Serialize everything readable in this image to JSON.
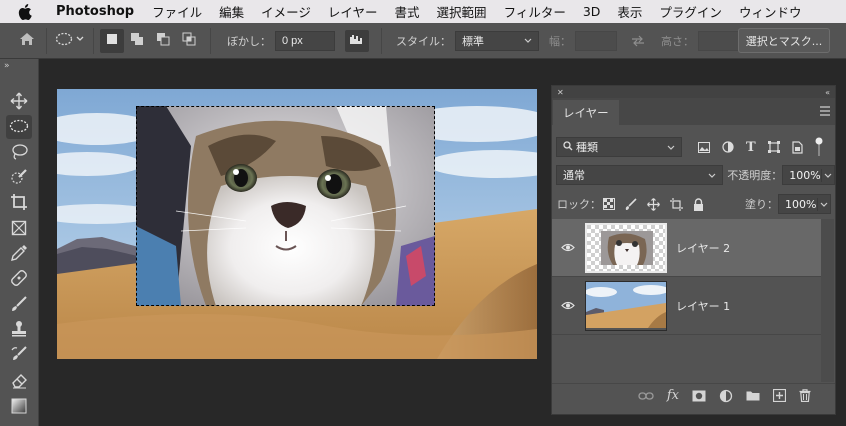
{
  "menubar": {
    "app_name": "Photoshop",
    "items": [
      "ファイル",
      "編集",
      "イメージ",
      "レイヤー",
      "書式",
      "選択範囲",
      "フィルター",
      "3D",
      "表示",
      "プラグイン",
      "ウィンドウ"
    ]
  },
  "options": {
    "feather_label": "ぼかし：",
    "feather_value": "0 px",
    "style_label": "スタイル：",
    "style_value": "標準",
    "width_label": "幅：",
    "height_label": "高さ：",
    "select_mask_label": "選択とマスク..."
  },
  "tools": [
    "move-tool",
    "elliptical-marquee-tool",
    "lasso-tool",
    "quick-selection-tool",
    "crop-tool",
    "frame-tool",
    "eyedropper-tool",
    "healing-brush-tool",
    "brush-tool",
    "clone-stamp-tool",
    "history-brush-tool",
    "eraser-tool",
    "gradient-tool"
  ],
  "layers_panel": {
    "tab_label": "レイヤー",
    "filter_kind": "種類",
    "blend_mode": "通常",
    "opacity_label": "不透明度：",
    "opacity_value": "100%",
    "lock_label": "ロック：",
    "fill_label": "塗り：",
    "fill_value": "100%",
    "layers": [
      {
        "name": "レイヤー 2",
        "visible": true,
        "selected": true
      },
      {
        "name": "レイヤー 1",
        "visible": true,
        "selected": false
      }
    ],
    "footer_fx": "fx"
  },
  "colors": {
    "ui_dark": "#535353",
    "workspace": "#282828",
    "menubar": "#e9e7ea",
    "selected_layer": "#686868"
  }
}
